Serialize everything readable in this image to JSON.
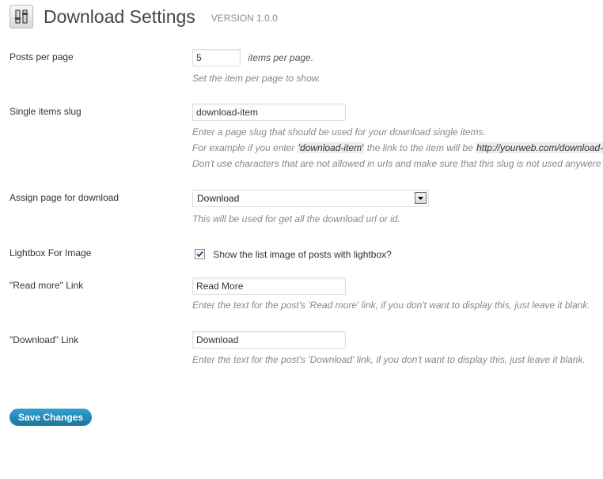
{
  "header": {
    "title": "Download Settings",
    "version": "VERSION 1.0.0",
    "icon": "settings-sliders-icon"
  },
  "posts_per_page": {
    "label": "Posts per page",
    "value": "5",
    "suffix": "items per page.",
    "description": "Set the item per page to show."
  },
  "single_slug": {
    "label": "Single items slug",
    "value": "download-item",
    "desc_line1": "Enter a page slug that should be used for your download single items.",
    "desc_line2_prefix": "For example if you enter ",
    "desc_line2_example": "'download-item'",
    "desc_line2_middle": " the link to the item will be ",
    "desc_line2_url": "http://yourweb.com/download-item/item-name",
    "desc_line3": "Don't use characters that are not allowed in urls and make sure that this slug is not used anywere else on your site."
  },
  "assign_page": {
    "label": "Assign page for download",
    "selected": "Download",
    "description": "This will be used for get all the download url or id."
  },
  "lightbox": {
    "label": "Lightbox For Image",
    "checked": true,
    "checkbox_label": "Show the list image of posts with lightbox?"
  },
  "read_more": {
    "label": "\"Read more\" Link",
    "value": "Read More",
    "description": "Enter the text for the post's 'Read more' link, if you don't want to display this, just leave it blank."
  },
  "download_link": {
    "label": "\"Download\" Link",
    "value": "Download",
    "description": "Enter the text for the post's 'Download' link, if you don't want to display this, just leave it blank."
  },
  "actions": {
    "save_label": "Save Changes"
  },
  "colors": {
    "button_primary": "#21759b",
    "description_text": "#888888"
  }
}
